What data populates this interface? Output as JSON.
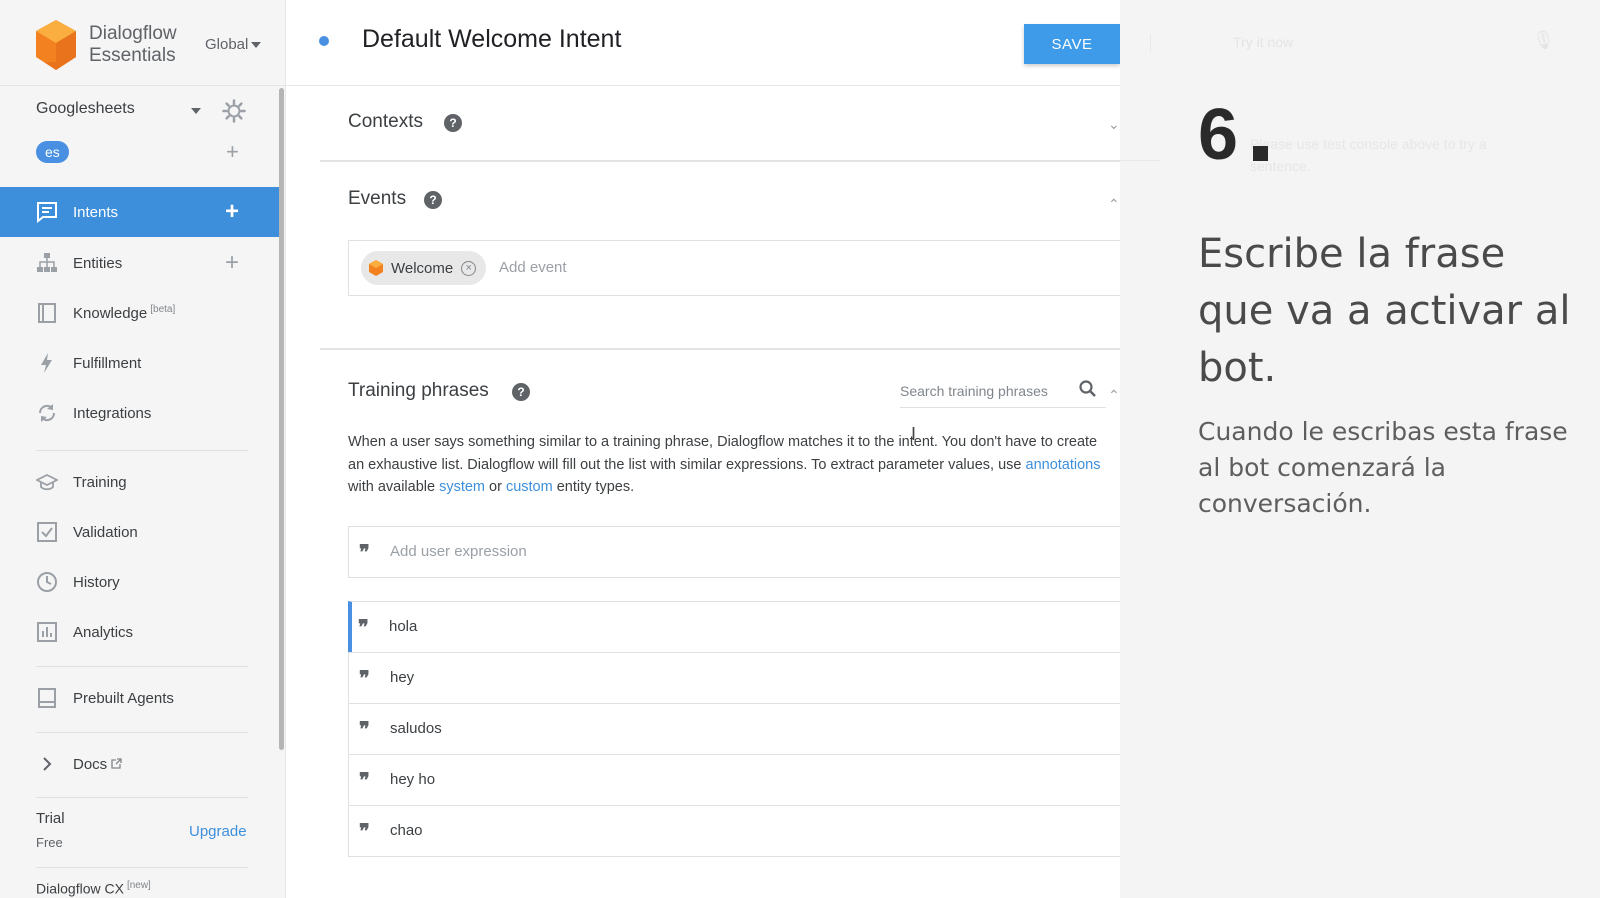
{
  "brand": {
    "line1": "Dialogflow",
    "line2": "Essentials",
    "region": "Global",
    "logo_color": "#f48120"
  },
  "agent": {
    "name": "Googlesheets",
    "language": "es"
  },
  "nav": {
    "intents": "Intents",
    "entities": "Entities",
    "knowledge": "Knowledge",
    "knowledge_badge": "[beta]",
    "fulfillment": "Fulfillment",
    "integrations": "Integrations",
    "training": "Training",
    "validation": "Validation",
    "history": "History",
    "analytics": "Analytics",
    "prebuilt": "Prebuilt Agents",
    "docs": "Docs",
    "plus": "+",
    "active_color": "#3d8fdc"
  },
  "plan": {
    "tier": "Trial",
    "price": "Free",
    "upgrade": "Upgrade",
    "cx": "Dialogflow CX",
    "cx_badge": "[new]"
  },
  "intent": {
    "title": "Default Welcome Intent",
    "save_label": "SAVE"
  },
  "contexts": {
    "title": "Contexts"
  },
  "events": {
    "title": "Events",
    "chip": "Welcome",
    "add_placeholder": "Add event"
  },
  "training": {
    "title": "Training phrases",
    "search_placeholder": "Search training phrases",
    "desc_part1": "When a user says something similar to a training phrase, Dialogflow matches it to the intent. You don't have to create an exhaustive list. Dialogflow will fill out the list with similar expressions. To extract parameter values, use ",
    "link_annotations": "annotations",
    "desc_part2": " with available ",
    "link_system": "system",
    "desc_part3": " or ",
    "link_custom": "custom",
    "desc_part4": " entity types.",
    "add_placeholder": "Add user expression",
    "phrases": [
      "hola",
      "hey",
      "saludos",
      "hey ho",
      "chao"
    ]
  },
  "overlay": {
    "step": "6",
    "headline": "Escribe la frase que va a activar al bot.",
    "subline": "Cuando le escribas esta frase al bot comenzará la conversación.",
    "ghost_try": "Try it now",
    "ghost_hint": "Please use test console above to try a sentence."
  }
}
